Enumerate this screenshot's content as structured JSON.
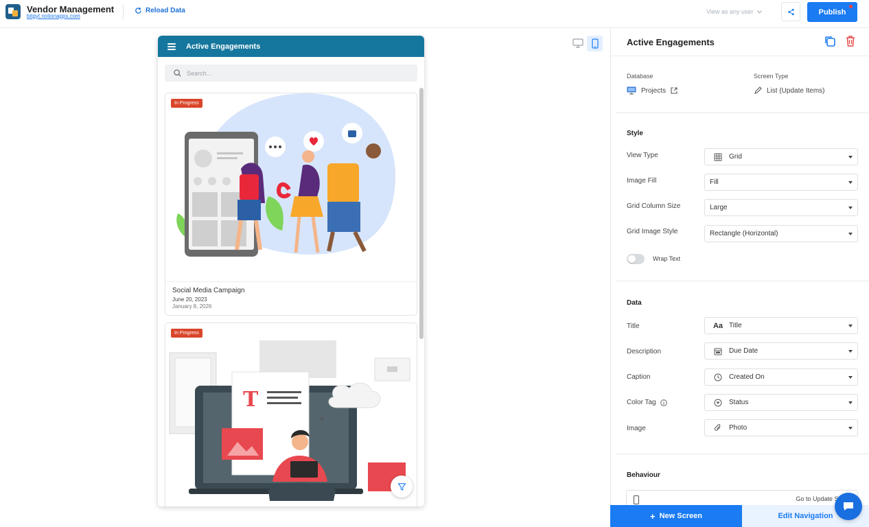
{
  "app": {
    "title": "Vendor Management",
    "url": "bitgyt.notionapps.com",
    "reload_label": "Reload Data",
    "view_as": "View as any user",
    "publish_label": "Publish"
  },
  "preview": {
    "screen_title": "Active Engagements",
    "search_placeholder": "Search...",
    "cards": [
      {
        "tag": "In Progress",
        "title": "Social Media Campaign",
        "description": "June 20, 2023",
        "caption": "January 8, 2026"
      },
      {
        "tag": "In Progress"
      }
    ]
  },
  "panel": {
    "title": "Active Engagements",
    "database_label": "Database",
    "database_value": "Projects",
    "screen_type_label": "Screen Type",
    "screen_type_value": "List (Update Items)",
    "style": {
      "title": "Style",
      "rows": [
        {
          "label": "View Type",
          "value": "Grid",
          "icon": "grid-icon"
        },
        {
          "label": "Image Fill",
          "value": "Fill"
        },
        {
          "label": "Grid Column Size",
          "value": "Large"
        },
        {
          "label": "Grid Image Style",
          "value": "Rectangle (Horizontal)"
        }
      ],
      "wrap_text_label": "Wrap Text"
    },
    "data": {
      "title": "Data",
      "rows": [
        {
          "label": "Title",
          "value": "Title",
          "icon": "text-aa-icon"
        },
        {
          "label": "Description",
          "value": "Due Date",
          "icon": "calendar-icon"
        },
        {
          "label": "Caption",
          "value": "Created On",
          "icon": "clock-icon"
        },
        {
          "label": "Color Tag",
          "value": "Status",
          "icon": "status-icon"
        },
        {
          "label": "Image",
          "value": "Photo",
          "icon": "paperclip-icon"
        }
      ]
    },
    "behaviour": {
      "title": "Behaviour",
      "action_text": "Go to Update Scree"
    }
  },
  "footer": {
    "new_screen_label": "New Screen",
    "edit_navigation_label": "Edit Navigation"
  },
  "colors": {
    "primary": "#1a7bf2",
    "header": "#15779d",
    "tag": "#d9462b"
  }
}
